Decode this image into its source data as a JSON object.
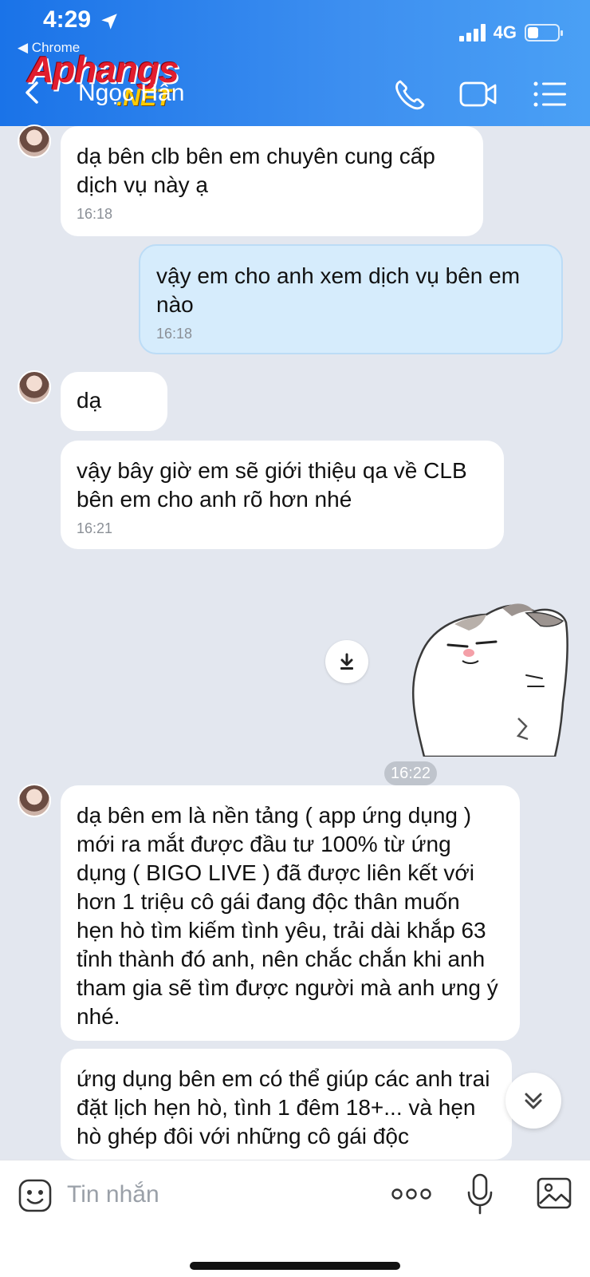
{
  "status_bar": {
    "time": "4:29",
    "back_app": "◀ Chrome",
    "network": "4G",
    "battery_level": 0.25
  },
  "watermark": {
    "brand": "Aphangs",
    "suffix": ".NET"
  },
  "header": {
    "contact_name": "Ngọc Hân",
    "icons": [
      "back-icon",
      "phone-icon",
      "video-call-icon",
      "menu-icon"
    ]
  },
  "messages": [
    {
      "direction": "in",
      "text": "dạ bên clb bên em chuyên cung cấp dịch vụ này ạ",
      "time": "16:18"
    },
    {
      "direction": "out",
      "text": "vậy em cho anh xem dịch vụ bên em nào",
      "time": "16:18"
    },
    {
      "direction": "in",
      "text": "dạ",
      "time": ""
    },
    {
      "direction": "in",
      "text": "vậy bây giờ em sẽ giới thiệu qa về CLB bên em cho anh rõ hơn nhé",
      "time": "16:21"
    },
    {
      "direction": "out",
      "type": "sticker",
      "time": "16:22"
    },
    {
      "direction": "in",
      "text": "dạ bên em là nền tảng ( app ứng dụng ) mới ra mắt được đầu tư 100% từ ứng dụng ( BIGO LIVE ) đã được liên kết với hơn 1 triệu cô gái đang độc thân muốn hẹn hò tìm kiếm tình yêu, trải dài khắp 63 tỉnh thành đó anh, nên chắc chắn khi anh tham gia sẽ tìm được người mà anh ưng ý nhé.",
      "time": ""
    },
    {
      "direction": "in",
      "text": "ứng dụng bên em có thể giúp các anh trai đặt lịch hẹn hò, tình 1 đêm 18+... và hẹn hò ghép đôi với những cô gái độc",
      "time": ""
    }
  ],
  "composer": {
    "placeholder": "Tin nhắn"
  },
  "colors": {
    "header": "#1a73e8",
    "outgoing_bubble": "#d6ecfc",
    "background": "#e3e7ef"
  }
}
